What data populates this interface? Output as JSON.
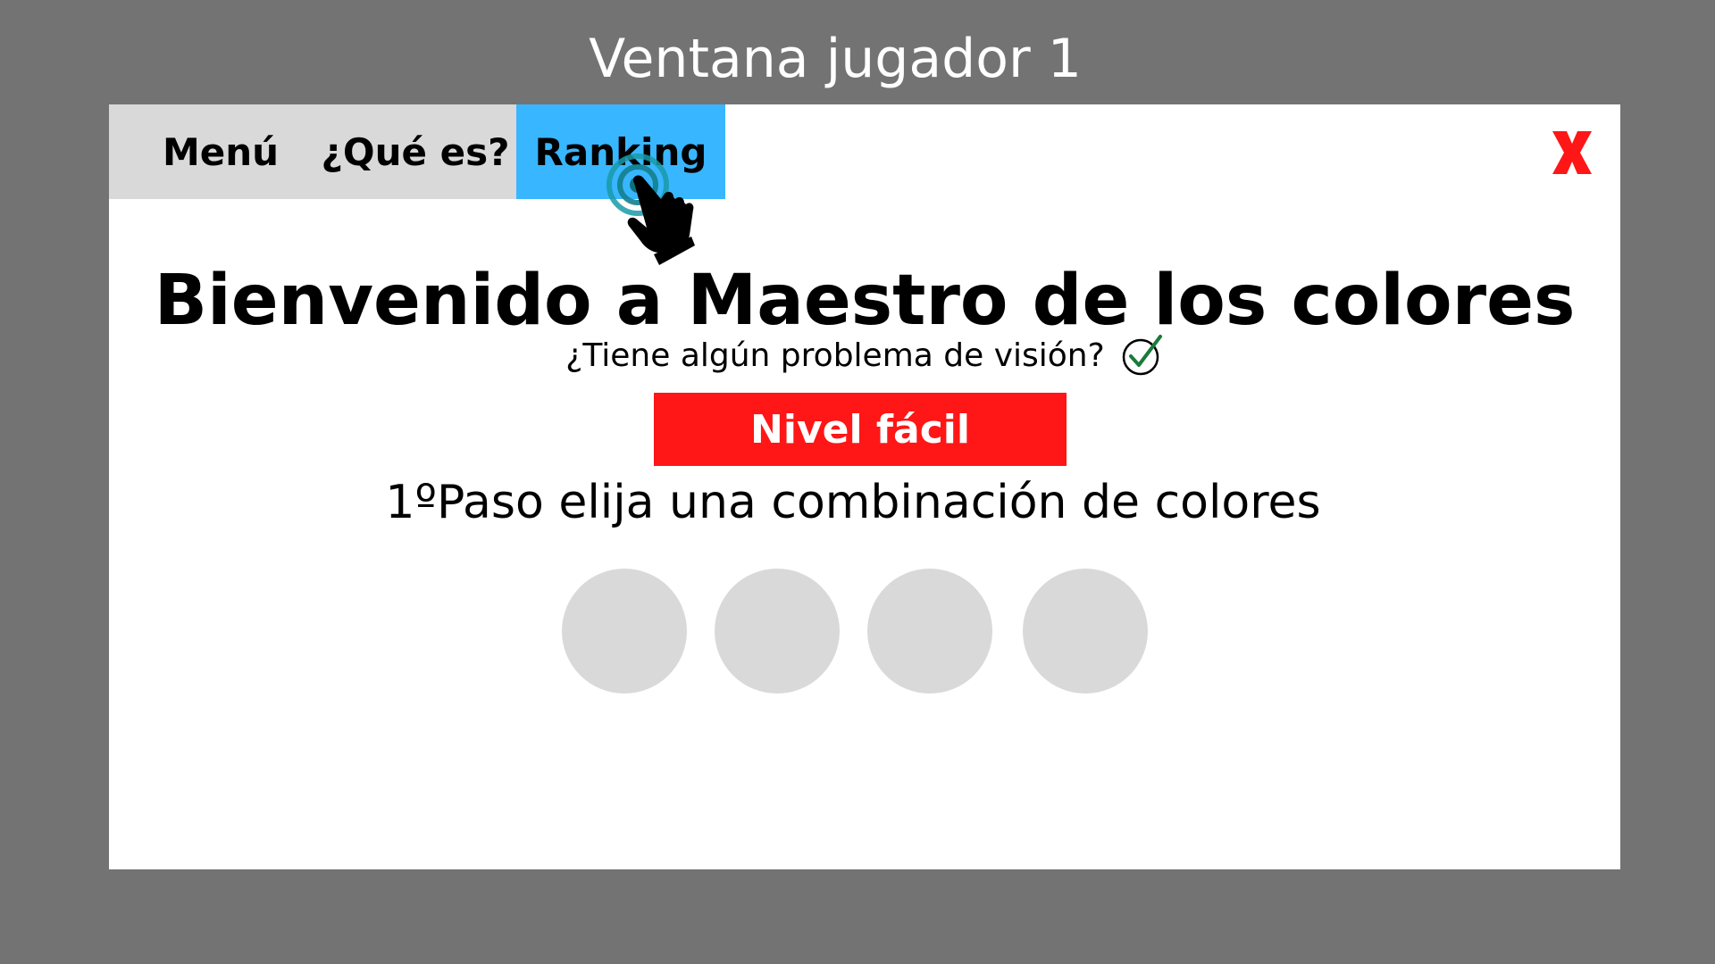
{
  "page": {
    "title": "Ventana jugador 1"
  },
  "window": {
    "menu": [
      {
        "label": "Menú"
      },
      {
        "label": "¿Qué es?"
      },
      {
        "label": "Ranking",
        "active": true
      }
    ],
    "close_label": "X",
    "close_icon": "close-x-icon",
    "pointer_icon": "hand-pointer-icon",
    "heading": "Bienvenido a Maestro de los colores",
    "vision_question": "¿Tiene algún problema de visión?",
    "vision_check_icon": "checkmark-circle-icon",
    "level_button": "Nivel fácil",
    "step_text": "1ºPaso elija una combinación de colores",
    "color_slots_count": 4
  },
  "colors": {
    "background": "#737373",
    "window": "#ffffff",
    "menubar": "#d9d9d9",
    "active_tab": "#38b6ff",
    "close": "#ff1616",
    "level_button": "#ff1616",
    "color_slot_empty": "#d9d9d9",
    "check": "#1a7a3a"
  }
}
